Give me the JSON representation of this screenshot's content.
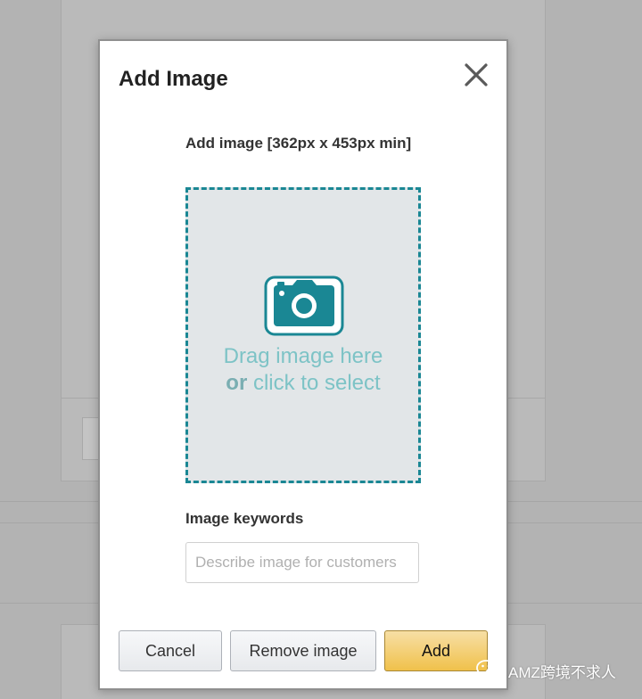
{
  "dialog": {
    "title": "Add Image",
    "close_icon": "close-icon"
  },
  "upload": {
    "label": "Add image [362px x 453px min]",
    "icon": "camera-icon",
    "drop_text_line1": "Drag image here",
    "drop_text_or": "or",
    "drop_text_line2": " click to select",
    "border_color": "#1a8794",
    "background_color": "#e2e6e8"
  },
  "keywords": {
    "label": "Image keywords",
    "placeholder": "Describe image for customers",
    "value": ""
  },
  "buttons": {
    "cancel": "Cancel",
    "remove": "Remove image",
    "add": "Add",
    "add_color": "#f0c14b"
  },
  "watermark": {
    "text": "AMZ跨境不求人",
    "icon": "wechat-icon"
  }
}
